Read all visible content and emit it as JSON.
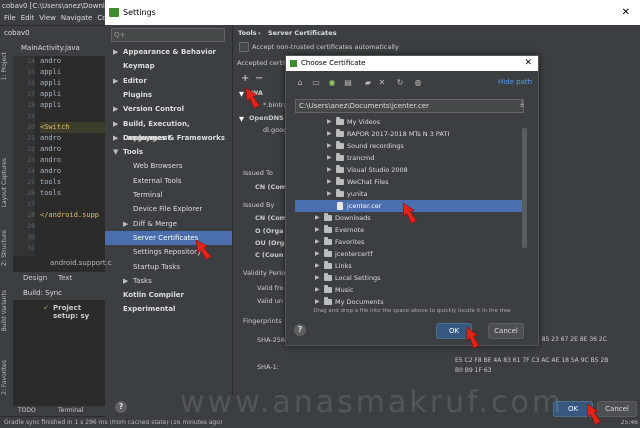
{
  "ide": {
    "title": "cobav0 [C:\\Users\\anez\\Downloads",
    "menu": [
      "File",
      "Edit",
      "View",
      "Navigate",
      "Code"
    ],
    "project_name": "cobav0",
    "tab_file": "MainActivity.java",
    "line_numbers": [
      "14",
      "15",
      "16",
      "17",
      "18",
      "19",
      "20",
      "21",
      "22",
      "23",
      "24",
      "25",
      "26",
      "27",
      "28",
      "29",
      "30",
      "31"
    ],
    "code_lines": [
      "andro",
      "appli",
      "appli",
      "appli",
      "appli",
      "",
      "<Switch",
      "andro",
      "andro",
      "andro",
      "andro",
      "tools",
      "tools",
      "",
      "</android.supp",
      "",
      "",
      ""
    ],
    "breadcrumb": "android.support.c",
    "design_tab": "Design",
    "text_tab": "Text",
    "build_sync": "Build: Sync",
    "project_setup": "Project setup: sy",
    "left_tabs": [
      "1: Project",
      "Layout Captures",
      "Z: Structure",
      "Build Variants",
      "2: Favorites"
    ],
    "bottom_todo": "TODO",
    "bottom_terminal": "Terminal",
    "status": "Gradle sync finished in 1 s 296 ms (from cached state) (16 minutes ago)",
    "status_right": "25:46"
  },
  "settings": {
    "title": "Settings",
    "search_placeholder": "Q+",
    "sidebar": [
      {
        "label": "Appearance & Behavior",
        "bold": true,
        "arrow": "▶",
        "level": 0
      },
      {
        "label": "Keymap",
        "bold": true,
        "arrow": "",
        "level": 0
      },
      {
        "label": "Editor",
        "bold": true,
        "arrow": "▶",
        "level": 0
      },
      {
        "label": "Plugins",
        "bold": true,
        "arrow": "",
        "level": 0
      },
      {
        "label": "Version Control",
        "bold": true,
        "arrow": "▶",
        "level": 0
      },
      {
        "label": "Build, Execution, Deployment",
        "bold": true,
        "arrow": "▶",
        "level": 0
      },
      {
        "label": "Languages & Frameworks",
        "bold": true,
        "arrow": "▶",
        "level": 0
      },
      {
        "label": "Tools",
        "bold": true,
        "arrow": "▼",
        "level": 0
      },
      {
        "label": "Web Browsers",
        "bold": false,
        "arrow": "",
        "level": 1
      },
      {
        "label": "External Tools",
        "bold": false,
        "arrow": "",
        "level": 1
      },
      {
        "label": "Terminal",
        "bold": false,
        "arrow": "",
        "level": 1
      },
      {
        "label": "Device File Explorer",
        "bold": false,
        "arrow": "",
        "level": 1
      },
      {
        "label": "Diff & Merge",
        "bold": false,
        "arrow": "▶",
        "level": 1
      },
      {
        "label": "Server Certificates",
        "bold": false,
        "arrow": "",
        "level": 1,
        "selected": true
      },
      {
        "label": "Settings Repository",
        "bold": false,
        "arrow": "",
        "level": 1
      },
      {
        "label": "Startup Tasks",
        "bold": false,
        "arrow": "",
        "level": 1
      },
      {
        "label": "Tasks",
        "bold": false,
        "arrow": "▶",
        "level": 1
      },
      {
        "label": "Kotlin Compiler",
        "bold": true,
        "arrow": "",
        "level": 0
      },
      {
        "label": "Experimental",
        "bold": true,
        "arrow": "",
        "level": 0
      }
    ],
    "breadcrumb_tools": "Tools",
    "breadcrumb_sep": "›",
    "breadcrumb_page": "Server Certificates",
    "accept_nontrusted": "Accept non-trusted certificates automatically",
    "accepted_cert": "Accepted certif",
    "tree_wa": "WA",
    "tree_bintra": "*.bintra",
    "tree_opendns": "OpenDNS",
    "tree_dlgoog": "dl.goog",
    "issued_to": "Issued To",
    "cn_to": "CN (Com",
    "issued_by": "Issued By",
    "cn_by": "CN (Com",
    "o_org": "O (Orga",
    "ou_org": "OU (Orga",
    "c_country": "C (Coun",
    "validity": "Validity Perio",
    "valid_from": "Valid fro",
    "valid_until": "Valid un",
    "fingerprints": "Fingerprints",
    "sha256": "SHA-256:",
    "sha256_val": "7A 33 07 BA 74 46 B7 51 F7 85 23 67 2E 8E 36 2C",
    "sha1": "SHA-1:",
    "sha1_val1": "E5 C2 F8 BE 4A 83 61 7F C3 AC AE 18 5A 9C B5 2B",
    "sha1_val2": "B0 B9 1F 63",
    "ok": "OK",
    "cancel": "Cancel"
  },
  "chooser": {
    "title": "Choose Certificate",
    "hide_path": "Hide path",
    "path": "C:\\Users\\anez\\Documents\\jcenter.cer",
    "items": [
      {
        "label": "My Videos",
        "indent": 3,
        "type": "folder"
      },
      {
        "label": "RAPOR 2017-2018 MTs N 3 PATI",
        "indent": 3,
        "type": "folder"
      },
      {
        "label": "Sound recordings",
        "indent": 3,
        "type": "folder"
      },
      {
        "label": "trancmd",
        "indent": 3,
        "type": "folder"
      },
      {
        "label": "Visual Studio 2008",
        "indent": 3,
        "type": "folder"
      },
      {
        "label": "WeChat Files",
        "indent": 3,
        "type": "folder"
      },
      {
        "label": "yunita",
        "indent": 3,
        "type": "folder"
      },
      {
        "label": "jcenter.cer",
        "indent": 3,
        "type": "file",
        "selected": true
      },
      {
        "label": "Downloads",
        "indent": 2,
        "type": "folder"
      },
      {
        "label": "Evernote",
        "indent": 2,
        "type": "folder"
      },
      {
        "label": "Favorites",
        "indent": 2,
        "type": "folder"
      },
      {
        "label": "jcentercertf",
        "indent": 2,
        "type": "folder"
      },
      {
        "label": "Links",
        "indent": 2,
        "type": "folder"
      },
      {
        "label": "Local Settings",
        "indent": 2,
        "type": "folder"
      },
      {
        "label": "Music",
        "indent": 2,
        "type": "folder"
      },
      {
        "label": "My Documents",
        "indent": 2,
        "type": "folder"
      }
    ],
    "hint": "Drag and drop a file into the space above to quickly locate it in the tree",
    "ok": "OK",
    "cancel": "Cancel"
  },
  "watermark": "www.anasmakruf.com"
}
